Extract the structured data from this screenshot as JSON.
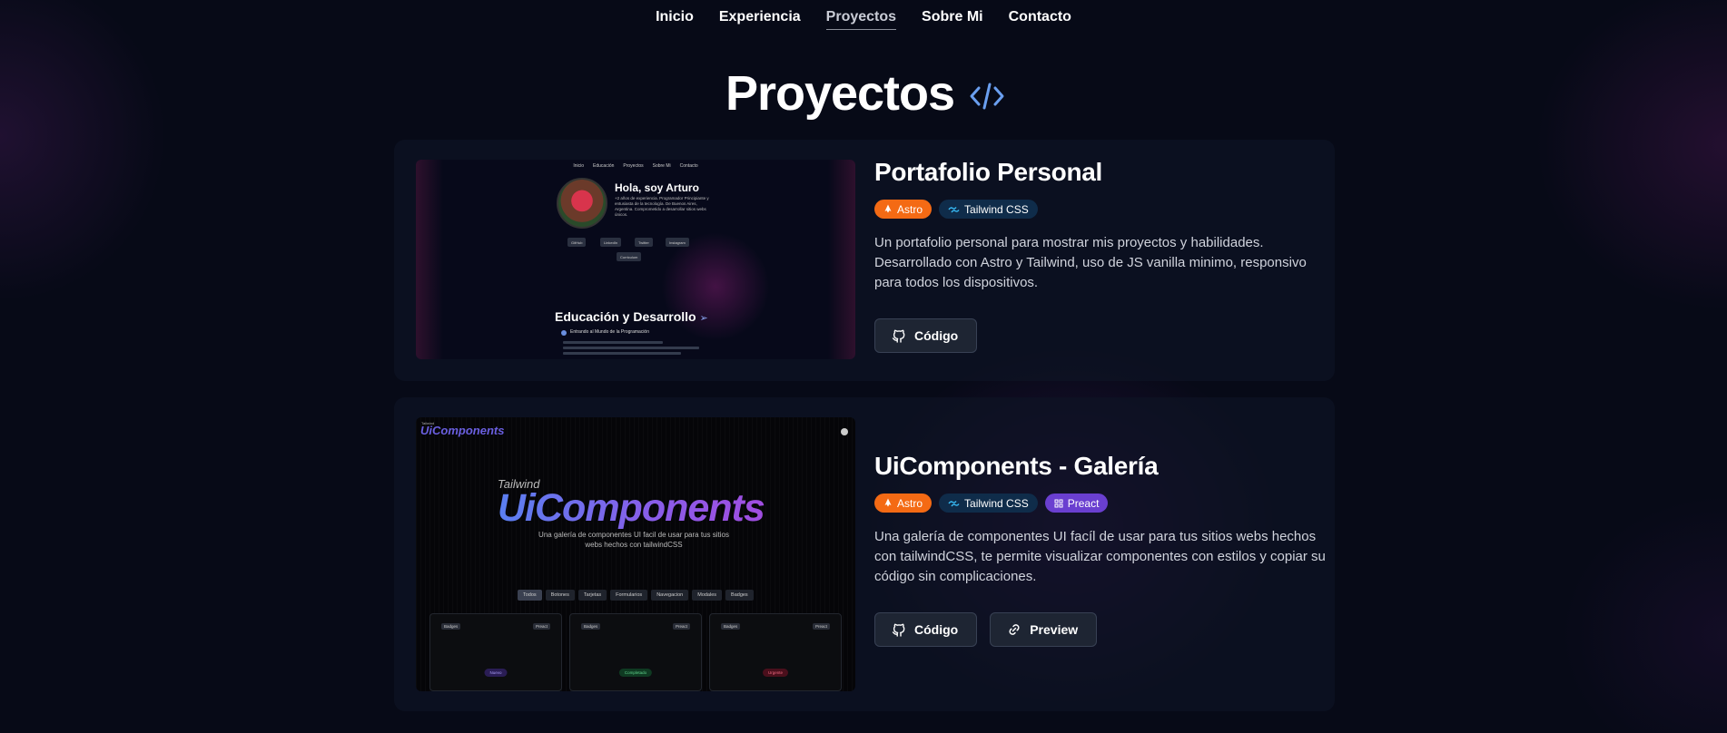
{
  "nav": {
    "items": [
      {
        "label": "Inicio",
        "active": false
      },
      {
        "label": "Experiencia",
        "active": false
      },
      {
        "label": "Proyectos",
        "active": true
      },
      {
        "label": "Sobre Mi",
        "active": false
      },
      {
        "label": "Contacto",
        "active": false
      }
    ]
  },
  "page": {
    "title": "Proyectos",
    "title_icon": "code-icon"
  },
  "colors": {
    "background": "#070a17",
    "accent_icon": "#6a9ff0",
    "tag_astro": "#f46a14",
    "tag_tailwind": "#0f2c4a",
    "tag_preact": "#6a3fd0"
  },
  "projects": [
    {
      "title": "Portafolio Personal",
      "tags": [
        {
          "label": "Astro",
          "icon": "astro-icon"
        },
        {
          "label": "Tailwind CSS",
          "icon": "tailwind-icon"
        }
      ],
      "description": "Un portafolio personal para mostrar mis proyectos y habilidades. Desarrollado con Astro y Tailwind, uso de JS vanilla minimo, responsivo para todos los dispositivos.",
      "buttons": [
        {
          "label": "Código",
          "icon": "github-icon"
        }
      ],
      "preview": {
        "nav": [
          "Inicio",
          "Educación",
          "Proyectos",
          "Sobre Mi",
          "Contacto"
        ],
        "greeting": "Hola, soy Arturo",
        "intro": "+2 años de experiencia. Programador Principiante y entusiasta de la tecnología. De Buenos Aires, Argentina. Comprometido a desarrollar sitios webs únicos.",
        "links": [
          "GitHub",
          "LinkedIn",
          "Twitter",
          "Instagram"
        ],
        "cv_label": "Curriculum",
        "section_title": "Educación y Desarrollo",
        "timeline_item": "Entrando al Mundo de la Programación"
      }
    },
    {
      "title": "UiComponents - Galería",
      "tags": [
        {
          "label": "Astro",
          "icon": "astro-icon"
        },
        {
          "label": "Tailwind CSS",
          "icon": "tailwind-icon"
        },
        {
          "label": "Preact",
          "icon": "preact-icon"
        }
      ],
      "description": "Una galería de componentes UI facíl de usar para tus sitios webs hechos con tailwindCSS, te permite visualizar componentes con estilos y copiar su código sin complicaciones.",
      "buttons": [
        {
          "label": "Código",
          "icon": "github-icon"
        },
        {
          "label": "Preview",
          "icon": "link-icon"
        }
      ],
      "preview": {
        "logo": "UiComponents",
        "logo_small": "Tailwind",
        "hero_small": "Tailwind",
        "hero_big": "UiComponents",
        "subtitle": "Una galería de componentes UI facil de usar para tus sitios webs hechos con tailwindCSS",
        "tabs": [
          "Todos",
          "Botones",
          "Tarjetas",
          "Formularios",
          "Navegacion",
          "Modales",
          "Badges"
        ],
        "cards": [
          {
            "badge_left": "Badges",
            "badge_right": "Preact",
            "pill": "Nuevo"
          },
          {
            "badge_left": "Badges",
            "badge_right": "Preact",
            "pill": "Completado"
          },
          {
            "badge_left": "Badges",
            "badge_right": "Preact",
            "pill": "Urgente"
          }
        ]
      }
    }
  ]
}
